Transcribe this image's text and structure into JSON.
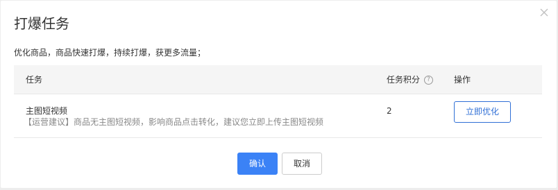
{
  "dialog": {
    "title": "打爆任务",
    "subtitle": "优化商品，商品快速打爆，持续打爆，获更多流量；",
    "close_icon": "close-icon"
  },
  "table": {
    "headers": {
      "task": "任务",
      "score": "任务积分",
      "score_help_icon": "question-circle-icon",
      "action": "操作"
    },
    "rows": [
      {
        "name": "主图短视频",
        "tip": "【运营建议】商品无主图短视频，影响商品点击转化，建议您立即上传主图短视频",
        "score": "2",
        "action_label": "立即优化"
      }
    ]
  },
  "footer": {
    "confirm_label": "确认",
    "cancel_label": "取消"
  },
  "colors": {
    "primary": "#3b82f6",
    "link_blue": "#2f6fd6"
  }
}
